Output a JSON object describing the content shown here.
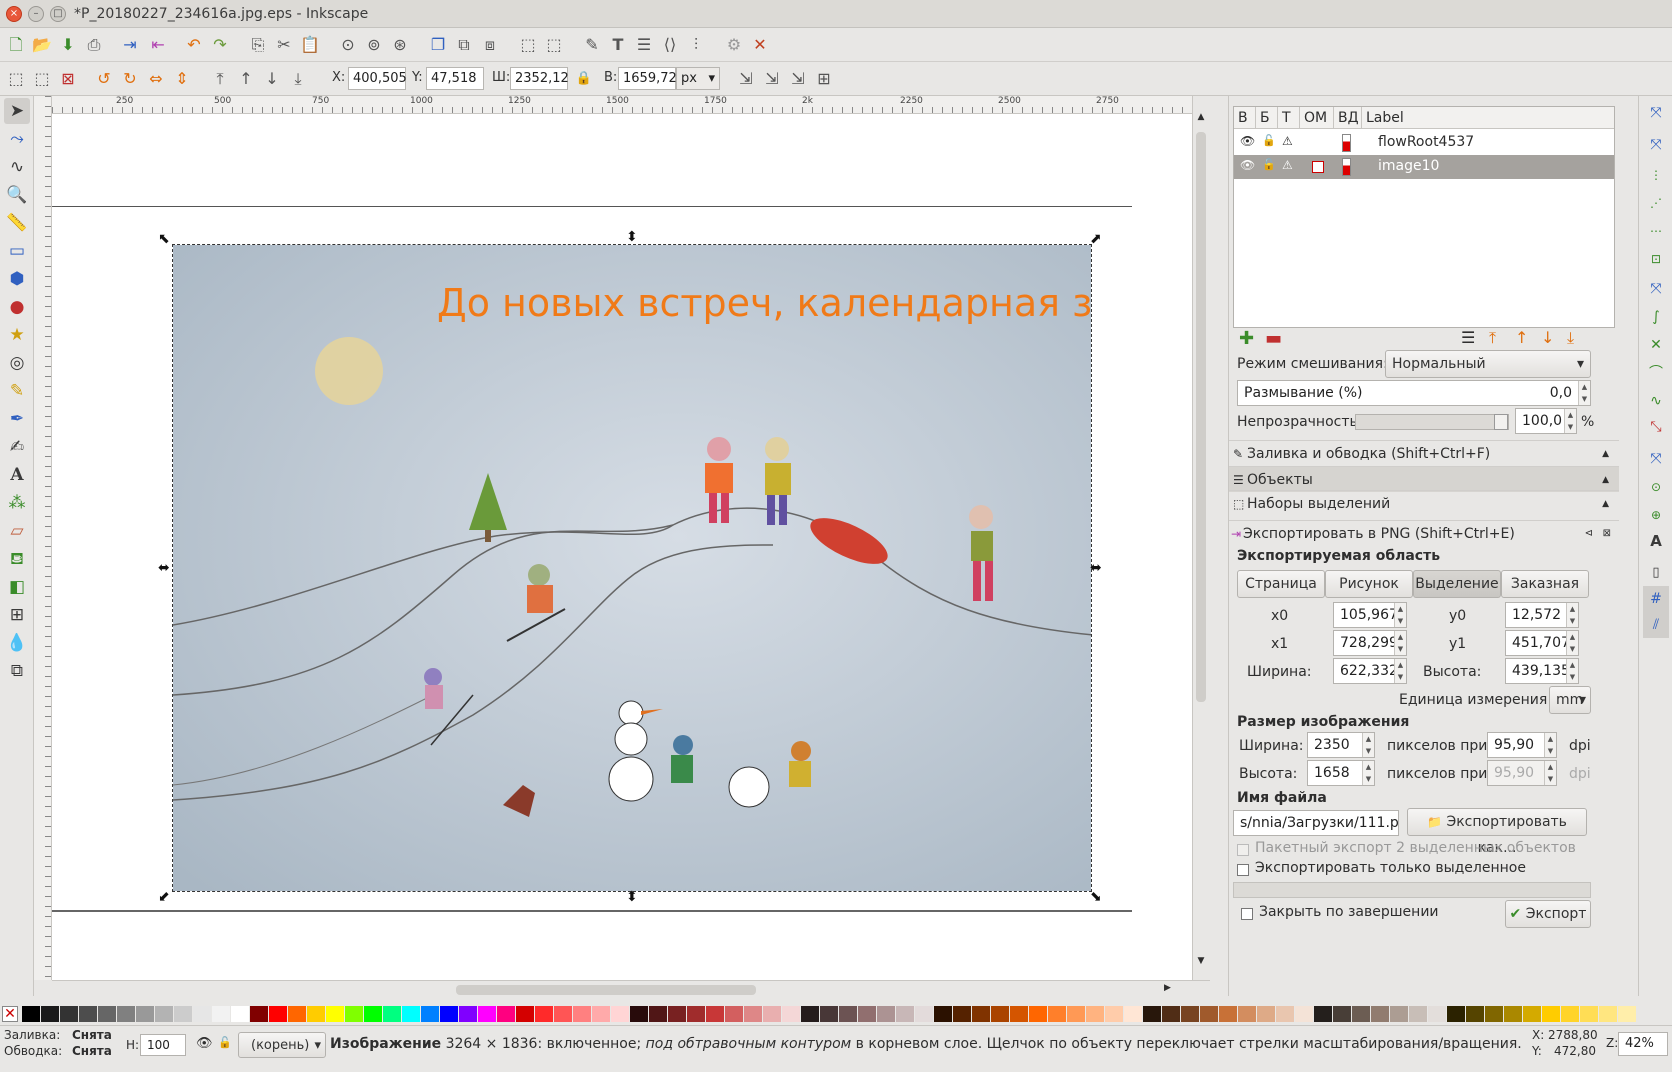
{
  "window": {
    "title": "*P_20180227_234616a.jpg.eps - Inkscape",
    "close": "×",
    "minimize": "–",
    "maximize": "□"
  },
  "toolctl": {
    "x_label": "X:",
    "x_value": "400,505",
    "y_label": "Y:",
    "y_value": "47,518",
    "w_label": "Ш:",
    "w_value": "2352,12",
    "h_label": "В:",
    "h_value": "1659,72",
    "unit": "px"
  },
  "ruler_h": [
    "250",
    "500",
    "750",
    "1000",
    "1250",
    "1500",
    "1750",
    "2k",
    "2250",
    "2500",
    "2750"
  ],
  "canvas": {
    "caption": "До новых встреч, календарная зима!",
    "caption_color": "#f07a18",
    "drawing_bg": "#b9c6d2"
  },
  "objects": {
    "columns": [
      "В",
      "Б",
      "Т",
      "ОМ",
      "ВД",
      "Label"
    ],
    "rows": [
      {
        "label": "flowRoot4537",
        "selected": false
      },
      {
        "label": "image10",
        "selected": true
      }
    ],
    "blend_label": "Режим смешивания:",
    "blend_value": "Нормальный",
    "blur_label": "Размывание (%)",
    "blur_value": "0,0",
    "opacity_label": "Непрозрачность:",
    "opacity_value": "100,0",
    "opacity_unit": "%"
  },
  "docked": {
    "fill_stroke": "Заливка и обводка (Shift+Ctrl+F)",
    "objects": "Объекты",
    "selection_sets": "Наборы выделений",
    "export_png": "Экспортировать в PNG (Shift+Ctrl+E)"
  },
  "export": {
    "area_heading": "Экспортируемая область",
    "tabs": [
      "Страница",
      "Рисунок",
      "Выделение",
      "Заказная"
    ],
    "active_tab": 2,
    "x0_label": "x0",
    "x0": "105,967",
    "y0_label": "y0",
    "y0": "12,572",
    "x1_label": "x1",
    "x1": "728,299",
    "y1_label": "y1",
    "y1": "451,707",
    "width_label": "Ширина:",
    "width": "622,332",
    "height_label": "Высота:",
    "height": "439,135",
    "unit_label": "Единица измерения:",
    "unit": "mm",
    "size_heading": "Размер изображения",
    "img_width_label": "Ширина:",
    "img_width": "2350",
    "img_height_label": "Высота:",
    "img_height": "1658",
    "pixels_at": "пикселов при",
    "dpi": "95,90",
    "dpi_disabled": "95,90",
    "dpi_unit": "dpi",
    "filename_heading": "Имя файла",
    "filename": "s/nnia/Загрузки/111.png",
    "export_as": "Экспортировать как...",
    "batch": "Пакетный экспорт 2 выделенных объектов",
    "only_selected": "Экспортировать только выделенное",
    "close_when_done": "Закрыть по завершении",
    "export_btn": "Экспорт"
  },
  "status": {
    "fill_label": "Заливка:",
    "fill_value": "Снята",
    "stroke_label": "Обводка:",
    "stroke_value": "Снята",
    "h_label": "Н:",
    "h_value": "100",
    "layer": "(корень)",
    "message_bold": "Изображение",
    "message_1": " 3264 × 1836: включенное; ",
    "message_italic": "под обтравочным контуром",
    "message_2": " в корневом слое. Щелчок по объекту переключает стрелки масштабирования/вращения.",
    "cx_label": "X:",
    "cx": "2788,80",
    "cy_label": "Y:",
    "cy": "472,80",
    "zoom_label": "Z:",
    "zoom": "42%"
  },
  "palette": [
    "#000000",
    "#1a1a1a",
    "#333333",
    "#4d4d4d",
    "#666666",
    "#808080",
    "#999999",
    "#b3b3b3",
    "#cccccc",
    "#e6e6e6",
    "#f2f2f2",
    "#ffffff",
    "#800000",
    "#ff0000",
    "#ff6600",
    "#ffcc00",
    "#ffff00",
    "#80ff00",
    "#00ff00",
    "#00ff80",
    "#00ffff",
    "#0080ff",
    "#0000ff",
    "#8000ff",
    "#ff00ff",
    "#ff0080",
    "#d40000",
    "#ff2a2a",
    "#ff5555",
    "#ff8080",
    "#ffaaaa",
    "#ffd5d5",
    "#280b0b",
    "#501616",
    "#782121",
    "#a02c2c",
    "#c83737",
    "#d35f5f",
    "#de8787",
    "#e9afaf",
    "#f4d7d7",
    "#241c1c",
    "#483737",
    "#6c5353",
    "#916f6f",
    "#ac9393",
    "#c8b7b7",
    "#e3dbdb",
    "#2b1100",
    "#552200",
    "#803300",
    "#aa4400",
    "#d45500",
    "#ff6600",
    "#ff7f2a",
    "#ff9955",
    "#ffb380",
    "#ffccaa",
    "#ffe6d5",
    "#28170b",
    "#502d16",
    "#784421",
    "#a05a2c",
    "#c87137",
    "#d38d5f",
    "#deaa87",
    "#e9c6af",
    "#f4e3d7",
    "#241f1c",
    "#483e37",
    "#6c5d53",
    "#917c6f",
    "#ac9d93",
    "#c8beb7",
    "#e3dedb",
    "#2b2200",
    "#554400",
    "#806600",
    "#aa8800",
    "#d4aa00",
    "#ffcc00",
    "#ffd42a",
    "#ffdd55",
    "#ffe680",
    "#ffeeaa"
  ]
}
